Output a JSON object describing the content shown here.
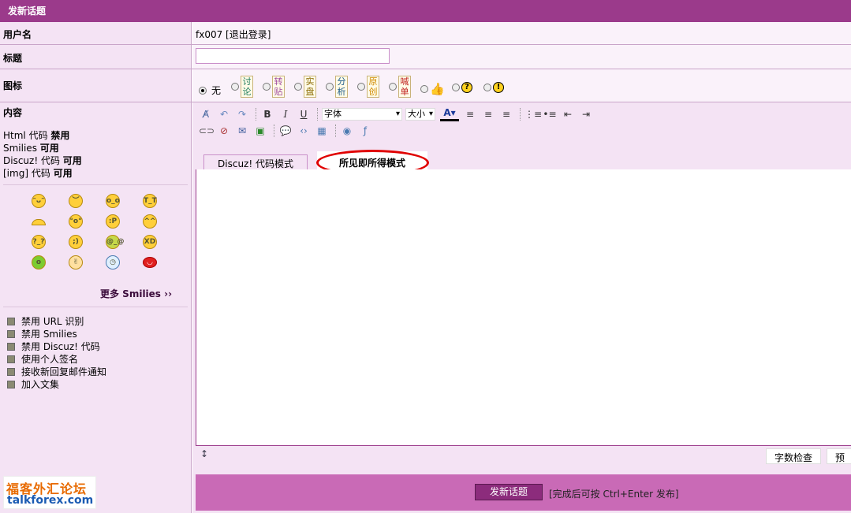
{
  "header": {
    "title": "发新话题"
  },
  "user_row": {
    "label": "用户名",
    "value": "fx007 [退出登录]"
  },
  "title_row": {
    "label": "标题",
    "value": ""
  },
  "icon_row": {
    "label": "图标",
    "none_label": "无",
    "stamps": [
      {
        "name": "discuss",
        "text": "讨论"
      },
      {
        "name": "repost",
        "text": "转贴"
      },
      {
        "name": "live-trade",
        "text": "实盘"
      },
      {
        "name": "analysis",
        "text": "分析"
      },
      {
        "name": "original",
        "text": "原创"
      },
      {
        "name": "call-order",
        "text": "喊单"
      }
    ]
  },
  "content_row": {
    "label": "内容",
    "info": [
      {
        "name": "Html 代码",
        "state": "禁用"
      },
      {
        "name": "Smilies",
        "state": "可用"
      },
      {
        "name": "Discuz! 代码",
        "state": "可用"
      },
      {
        "name": "[img] 代码",
        "state": "可用"
      }
    ],
    "more_smilies": "更多 Smilies ››",
    "options": [
      "禁用 URL 识别",
      "禁用 Smilies",
      "禁用 Discuz! 代码",
      "使用个人签名",
      "接收新回复邮件通知",
      "加入文集"
    ]
  },
  "toolbar": {
    "font_select": "字体",
    "size_select": "大小"
  },
  "tabs": [
    {
      "label": "Discuz! 代码模式",
      "active": false
    },
    {
      "label": "所见即所得模式",
      "active": true
    }
  ],
  "editor_buttons": {
    "word_check": "字数检查",
    "preview": "预览"
  },
  "submit": {
    "button": "发新话题",
    "hint": "[完成后可按 Ctrl+Enter 发布]"
  },
  "logo": {
    "line1": "福客外汇论坛",
    "line2": "talkforex.com"
  },
  "colors": {
    "header": "#9b3a8b",
    "submit_bar": "#c96ab6",
    "annotation": "#e00000"
  }
}
